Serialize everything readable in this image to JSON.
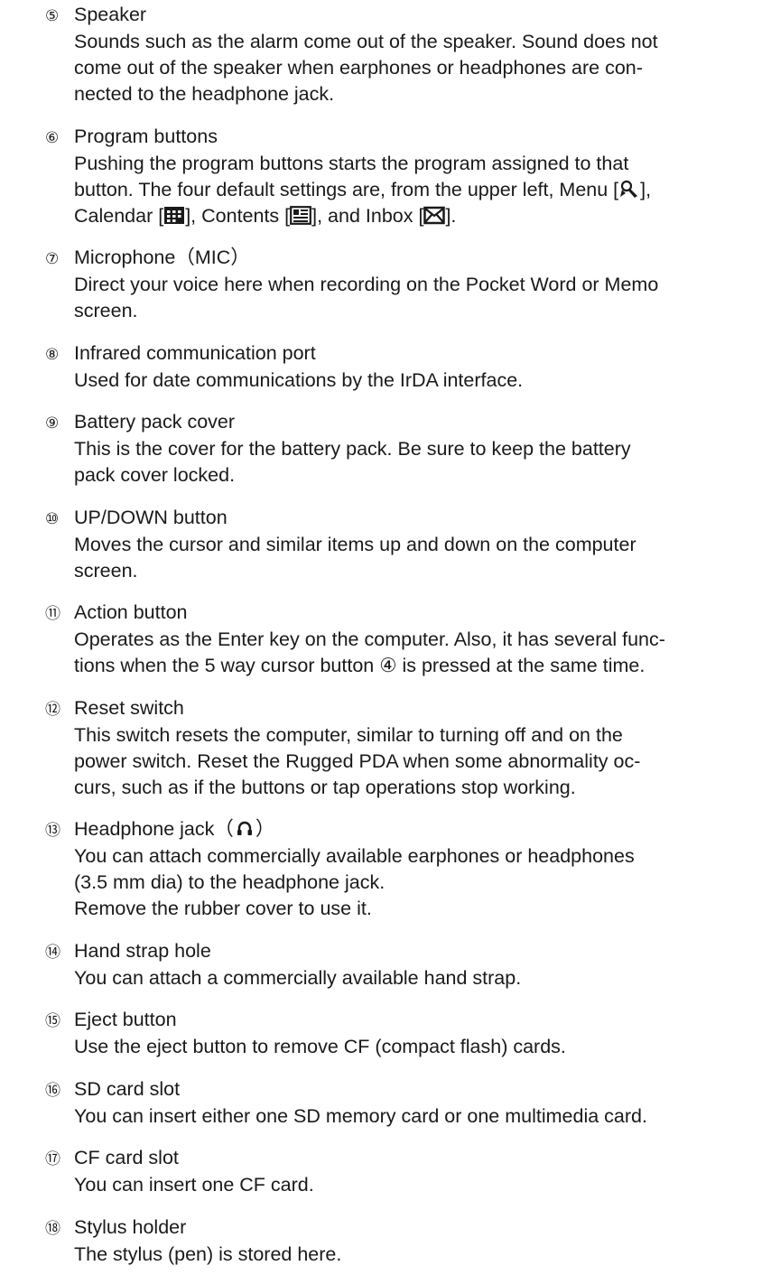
{
  "items": [
    {
      "num": "⑤",
      "title": "Speaker",
      "lines": [
        "Sounds such as the alarm come out of the speaker. Sound does not",
        "come out of the speaker when earphones or headphones are con-",
        "nected to the headphone jack."
      ]
    },
    {
      "num": "⑥",
      "title": "Program buttons",
      "lines": [
        "Pushing the program buttons starts the program assigned to that"
      ],
      "rich1": {
        "a": "button. The four default settings are, from the upper left, Menu [",
        "b": "],"
      },
      "rich2": {
        "a": "Calendar [",
        "b": "], Contents [",
        "c": "], and Inbox [",
        "d": "]."
      }
    },
    {
      "num": "⑦",
      "title": "Microphone（MIC）",
      "lines": [
        "Direct your voice here when recording on the Pocket Word or Memo",
        "screen."
      ]
    },
    {
      "num": "⑧",
      "title": "Infrared communication port",
      "lines": [
        "Used for date communications by the IrDA interface."
      ]
    },
    {
      "num": "⑨",
      "title": "Battery pack cover",
      "lines": [
        "This is the cover for the battery pack. Be sure to keep the battery",
        "pack cover locked."
      ]
    },
    {
      "num": "⑩",
      "title": "UP/DOWN button",
      "lines": [
        "Moves the cursor and similar items up and down on the computer",
        "screen."
      ]
    },
    {
      "num": "⑪",
      "title": "Action button",
      "lines": [
        "Operates as the Enter key on the computer. Also, it has several func-",
        "tions when the 5 way cursor button ④ is pressed at the same time."
      ]
    },
    {
      "num": "⑫",
      "title": "Reset switch",
      "lines": [
        "This switch resets the computer, similar to turning off and on the",
        "power switch. Reset the Rugged PDA when some abnormality oc-",
        "curs, such as if the buttons or tap operations stop working."
      ]
    },
    {
      "num": "⑬",
      "title": "Headphone jack（",
      "title_end": "）",
      "lines": [
        "You can attach commercially available earphones or headphones",
        "(3.5 mm dia) to the headphone jack.",
        "Remove the rubber cover to use it."
      ]
    },
    {
      "num": "⑭",
      "title": "Hand strap hole",
      "lines": [
        "You can attach a commercially available hand strap."
      ]
    },
    {
      "num": "⑮",
      "title": "Eject button",
      "lines": [
        "Use the eject button to remove CF (compact flash) cards."
      ]
    },
    {
      "num": "⑯",
      "title": "SD card slot",
      "lines": [
        "You can insert either one SD memory card or one multimedia card."
      ]
    },
    {
      "num": "⑰",
      "title": "CF card slot",
      "lines": [
        "You can insert one CF card."
      ]
    },
    {
      "num": "⑱",
      "title": "Stylus holder",
      "lines": [
        "The stylus (pen) is stored here."
      ]
    }
  ]
}
